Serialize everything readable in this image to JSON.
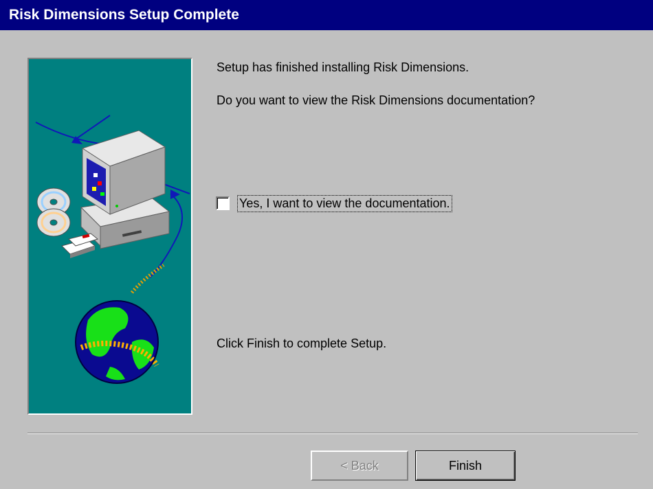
{
  "window": {
    "title": "Risk Dimensions Setup Complete"
  },
  "messages": {
    "finished": "Setup has finished installing Risk Dimensions.",
    "question": "Do you want to view the Risk Dimensions documentation?",
    "finish_hint": "Click Finish to complete Setup."
  },
  "checkbox": {
    "label": "Yes, I want to view the documentation.",
    "checked": false
  },
  "buttons": {
    "back_label": "< Back",
    "finish_label": "Finish"
  },
  "illustration": {
    "icons": [
      "computer-icon",
      "cd-icon",
      "floppy-disk-icon",
      "globe-icon"
    ]
  },
  "colors": {
    "titlebar": "#000080",
    "illustration_bg": "#008080",
    "dialog_bg": "#c0c0c0"
  }
}
